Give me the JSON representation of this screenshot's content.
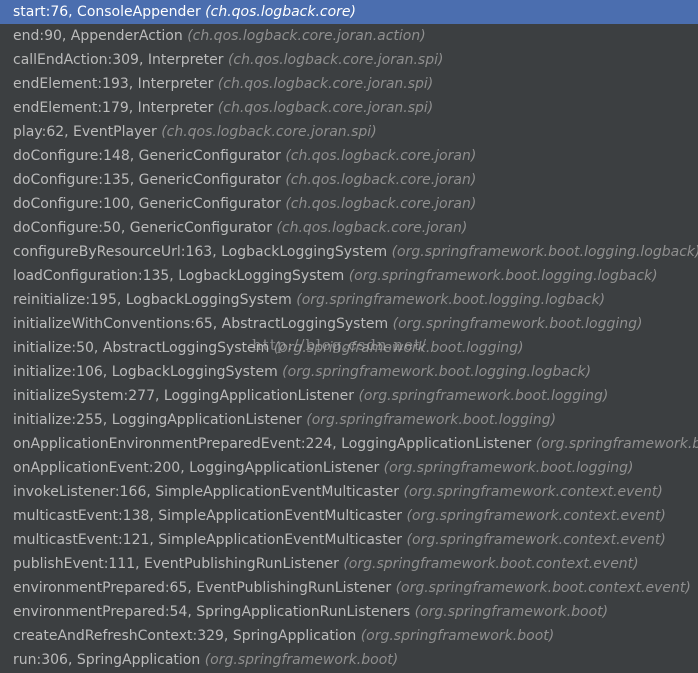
{
  "frames": [
    {
      "method": "start:76, ConsoleAppender",
      "pkg": "(ch.qos.logback.core)",
      "selected": true
    },
    {
      "method": "end:90, AppenderAction",
      "pkg": "(ch.qos.logback.core.joran.action)"
    },
    {
      "method": "callEndAction:309, Interpreter",
      "pkg": "(ch.qos.logback.core.joran.spi)"
    },
    {
      "method": "endElement:193, Interpreter",
      "pkg": "(ch.qos.logback.core.joran.spi)"
    },
    {
      "method": "endElement:179, Interpreter",
      "pkg": "(ch.qos.logback.core.joran.spi)"
    },
    {
      "method": "play:62, EventPlayer",
      "pkg": "(ch.qos.logback.core.joran.spi)"
    },
    {
      "method": "doConfigure:148, GenericConfigurator",
      "pkg": "(ch.qos.logback.core.joran)"
    },
    {
      "method": "doConfigure:135, GenericConfigurator",
      "pkg": "(ch.qos.logback.core.joran)"
    },
    {
      "method": "doConfigure:100, GenericConfigurator",
      "pkg": "(ch.qos.logback.core.joran)"
    },
    {
      "method": "doConfigure:50, GenericConfigurator",
      "pkg": "(ch.qos.logback.core.joran)"
    },
    {
      "method": "configureByResourceUrl:163, LogbackLoggingSystem",
      "pkg": "(org.springframework.boot.logging.logback)"
    },
    {
      "method": "loadConfiguration:135, LogbackLoggingSystem",
      "pkg": "(org.springframework.boot.logging.logback)"
    },
    {
      "method": "reinitialize:195, LogbackLoggingSystem",
      "pkg": "(org.springframework.boot.logging.logback)"
    },
    {
      "method": "initializeWithConventions:65, AbstractLoggingSystem",
      "pkg": "(org.springframework.boot.logging)"
    },
    {
      "method": "initialize:50, AbstractLoggingSystem",
      "pkg": "(org.springframework.boot.logging)"
    },
    {
      "method": "initialize:106, LogbackLoggingSystem",
      "pkg": "(org.springframework.boot.logging.logback)"
    },
    {
      "method": "initializeSystem:277, LoggingApplicationListener",
      "pkg": "(org.springframework.boot.logging)"
    },
    {
      "method": "initialize:255, LoggingApplicationListener",
      "pkg": "(org.springframework.boot.logging)"
    },
    {
      "method": "onApplicationEnvironmentPreparedEvent:224, LoggingApplicationListener",
      "pkg": "(org.springframework.boot.logging)"
    },
    {
      "method": "onApplicationEvent:200, LoggingApplicationListener",
      "pkg": "(org.springframework.boot.logging)"
    },
    {
      "method": "invokeListener:166, SimpleApplicationEventMulticaster",
      "pkg": "(org.springframework.context.event)"
    },
    {
      "method": "multicastEvent:138, SimpleApplicationEventMulticaster",
      "pkg": "(org.springframework.context.event)"
    },
    {
      "method": "multicastEvent:121, SimpleApplicationEventMulticaster",
      "pkg": "(org.springframework.context.event)"
    },
    {
      "method": "publishEvent:111, EventPublishingRunListener",
      "pkg": "(org.springframework.boot.context.event)"
    },
    {
      "method": "environmentPrepared:65, EventPublishingRunListener",
      "pkg": "(org.springframework.boot.context.event)"
    },
    {
      "method": "environmentPrepared:54, SpringApplicationRunListeners",
      "pkg": "(org.springframework.boot)"
    },
    {
      "method": "createAndRefreshContext:329, SpringApplication",
      "pkg": "(org.springframework.boot)"
    },
    {
      "method": "run:306, SpringApplication",
      "pkg": "(org.springframework.boot)"
    }
  ],
  "watermark": "http://blog.csdn.net/",
  "colors": {
    "background": "#3c3f41",
    "selected_background": "#4b6eaf",
    "method_text": "#bbbbbb",
    "package_text": "#8f8f8f"
  }
}
